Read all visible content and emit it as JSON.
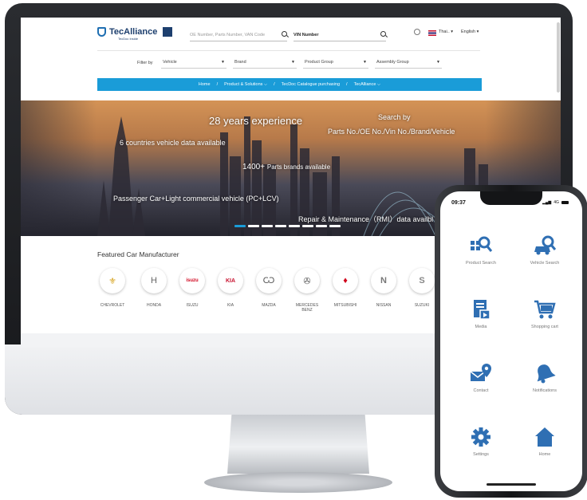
{
  "site": {
    "logo_text": "TecAlliance",
    "logo_sub": "TecDoc Inside",
    "search_placeholder": "OE Number, Parts Number, VAN Code",
    "vin_label": "VIN Number",
    "country": "Thai..",
    "language": "English",
    "filter_label": "Filter by",
    "filters": [
      "Vehicle",
      "Brand",
      "Product Group",
      "Assembly Group"
    ],
    "nav": [
      "Home",
      "/",
      "Product & Solutions ⌵",
      "/",
      "TecDoc Catalogue purchasing",
      "/",
      "TecAlliance ⌵"
    ],
    "hero": {
      "headline": "28 years experience",
      "countries": "6 countries vehicle data available",
      "search_by": "Search by",
      "search_fields": "Parts No./OE No./Vin No./Brand/Vehicle",
      "brands_count": "1400+",
      "brands_text": "Parts brands available",
      "vehicles": "Passenger Car+Light commercial vehicle (PC+LCV)",
      "rmi": "Repair & Maintenance（RMI）data availbl"
    },
    "featured_title": "Featured Car Manufacturer",
    "manufacturers": [
      {
        "name": "CHEVROLET",
        "icon": "chevrolet-logo-icon",
        "glyph": "⚜"
      },
      {
        "name": "HONDA",
        "icon": "honda-logo-icon",
        "glyph": "H"
      },
      {
        "name": "ISUZU",
        "icon": "isuzu-logo-icon",
        "glyph": "isuzu"
      },
      {
        "name": "KIA",
        "icon": "kia-logo-icon",
        "glyph": "KIA"
      },
      {
        "name": "MAZDA",
        "icon": "mazda-logo-icon",
        "glyph": "Ѡ"
      },
      {
        "name": "MERCEDES BENZ",
        "icon": "mercedes-logo-icon",
        "glyph": "✇"
      },
      {
        "name": "MITSUBISHI",
        "icon": "mitsubishi-logo-icon",
        "glyph": "♦"
      },
      {
        "name": "NISSAN",
        "icon": "nissan-logo-icon",
        "glyph": "N"
      },
      {
        "name": "SUZUKI",
        "icon": "suzuki-logo-icon",
        "glyph": "S"
      }
    ]
  },
  "phone": {
    "time": "09:37",
    "network": "4G",
    "tiles": [
      {
        "label": "Product Search",
        "icon": "product-search-icon"
      },
      {
        "label": "Vehicle Search",
        "icon": "vehicle-search-icon"
      },
      {
        "label": "Media",
        "icon": "media-icon"
      },
      {
        "label": "Shopping cart",
        "icon": "shopping-cart-icon"
      },
      {
        "label": "Contact",
        "icon": "contact-icon"
      },
      {
        "label": "Notifications",
        "icon": "notifications-icon"
      },
      {
        "label": "Settings",
        "icon": "settings-icon"
      },
      {
        "label": "Home",
        "icon": "home-icon"
      }
    ]
  },
  "colors": {
    "accent": "#1a9cd8",
    "brand_dark": "#1d3f6e",
    "phone_icon": "#2f6fb3"
  }
}
